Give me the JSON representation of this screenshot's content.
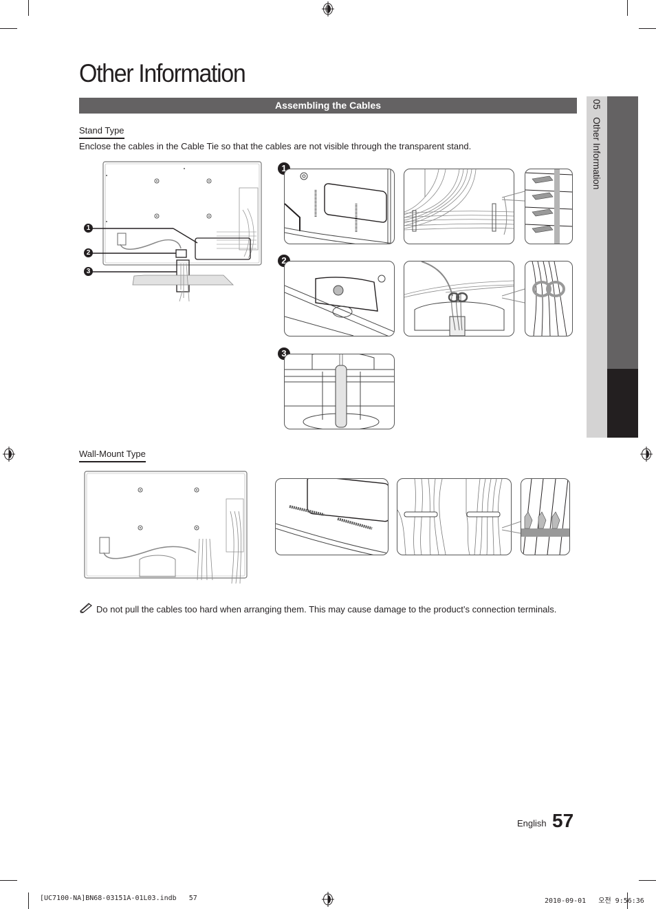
{
  "page": {
    "title": "Other Information",
    "section_title": "Assembling the Cables",
    "side_tab": {
      "chapter_number": "05",
      "chapter_label": "Other Information"
    },
    "stand_type": {
      "heading": "Stand Type",
      "instruction": "Enclose the cables in the Cable Tie so that the cables are not visible through the transparent stand.",
      "callouts": [
        "1",
        "2",
        "3"
      ],
      "step_badges": [
        "1",
        "2",
        "3"
      ]
    },
    "wall_mount_type": {
      "heading": "Wall-Mount Type"
    },
    "note": {
      "icon": "pencil-note-icon",
      "text": "Do not pull the cables too hard when arranging them. This may cause damage to the product’s connection terminals."
    },
    "footer": {
      "language": "English",
      "page_number": "57",
      "slug_left": "[UC7100-NA]BN68-03151A-01L03.indb   57",
      "slug_right": "2010-09-01   오전 9:56:36"
    }
  }
}
